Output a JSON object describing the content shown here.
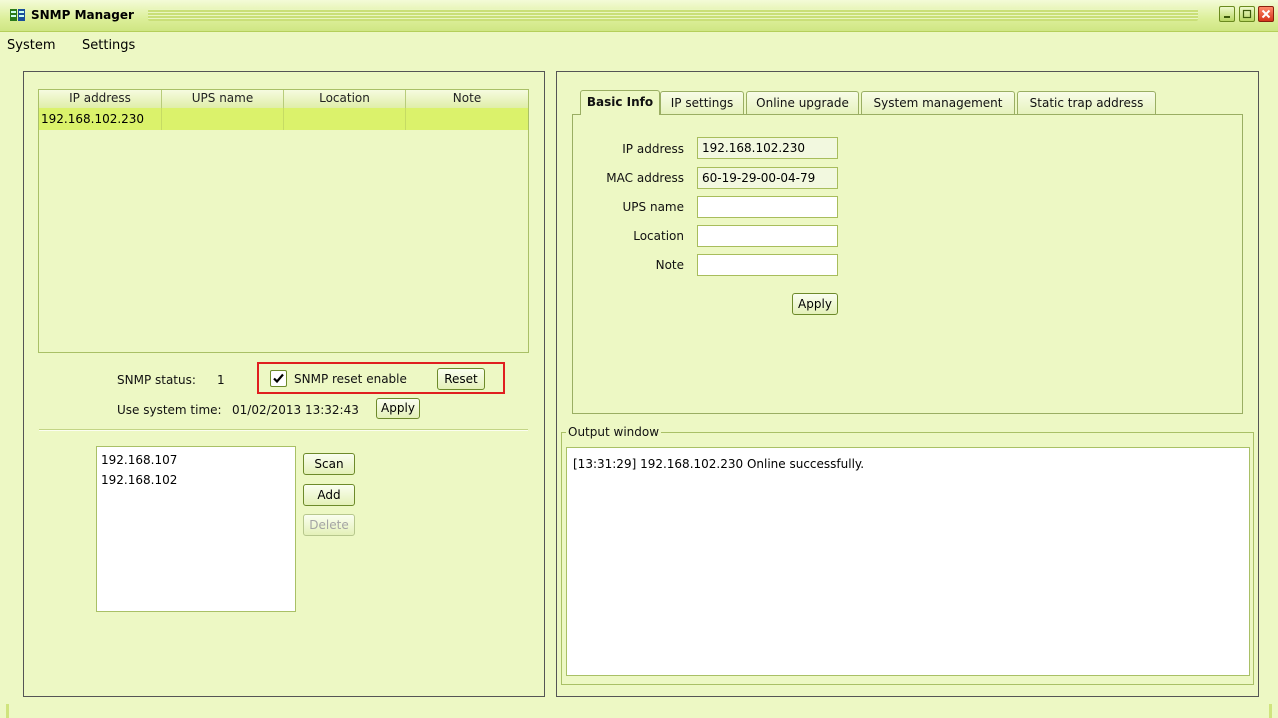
{
  "window": {
    "title": "SNMP Manager"
  },
  "menu": [
    "System",
    "Settings"
  ],
  "device_table": {
    "columns": [
      "IP address",
      "UPS name",
      "Location",
      "Note"
    ],
    "rows": [
      [
        "192.168.102.230",
        "",
        "",
        ""
      ]
    ]
  },
  "status": {
    "snmp_status_label": "SNMP status:",
    "snmp_status_value": "1",
    "reset_enable_label": "SNMP reset enable",
    "reset_enable_checked": true,
    "reset_button": "Reset",
    "system_time_label": "Use system time:",
    "system_time_value": "01/02/2013 13:32:43",
    "apply_button": "Apply"
  },
  "scan": {
    "items": [
      "192.168.107",
      "192.168.102"
    ],
    "scan_button": "Scan",
    "add_button": "Add",
    "delete_button": "Delete"
  },
  "tabs": [
    "Basic Info",
    "IP settings",
    "Online upgrade",
    "System management",
    "Static trap address"
  ],
  "basic_info": {
    "ip_label": "IP address",
    "ip_value": "192.168.102.230",
    "mac_label": "MAC address",
    "mac_value": "60-19-29-00-04-79",
    "ups_label": "UPS name",
    "ups_value": "",
    "location_label": "Location",
    "location_value": "",
    "note_label": "Note",
    "note_value": "",
    "apply_button": "Apply"
  },
  "output": {
    "legend": "Output window",
    "lines": [
      "[13:31:29]  192.168.102.230 Online successfully."
    ]
  },
  "colors": {
    "background": "#edf8c4",
    "selected_row": "#dbf26b",
    "highlight": "#e01f1f",
    "close_button": "#d6341a"
  }
}
